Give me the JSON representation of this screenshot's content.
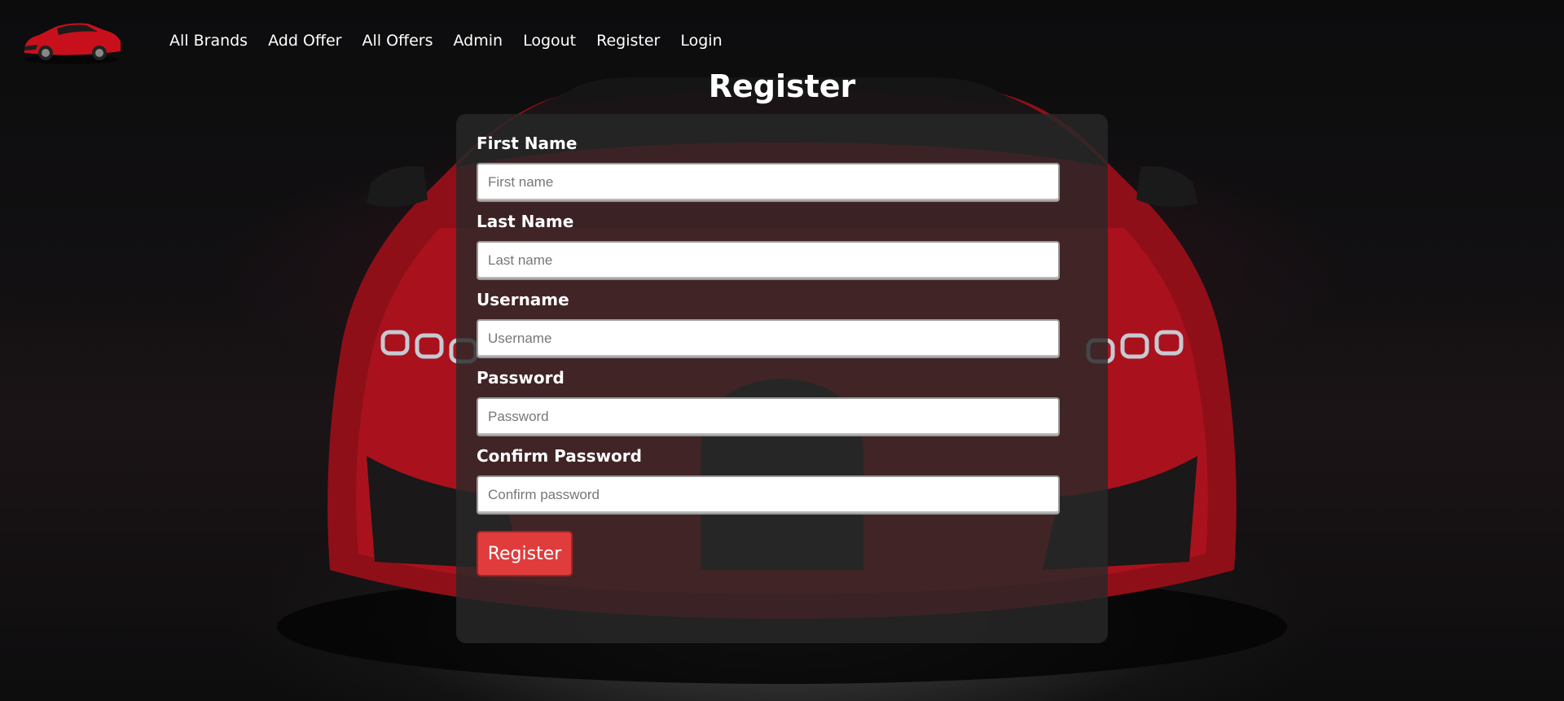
{
  "nav": {
    "logo_icon": "red-sports-car-logo",
    "links": [
      "All Brands",
      "Add Offer",
      "All Offers",
      "Admin",
      "Logout",
      "Register",
      "Login"
    ]
  },
  "page": {
    "title": "Register"
  },
  "form": {
    "fields": [
      {
        "label": "First Name",
        "placeholder": "First name",
        "value": ""
      },
      {
        "label": "Last Name",
        "placeholder": "Last name",
        "value": ""
      },
      {
        "label": "Username",
        "placeholder": "Username",
        "value": ""
      },
      {
        "label": "Password",
        "placeholder": "Password",
        "value": ""
      },
      {
        "label": "Confirm Password",
        "placeholder": "Confirm password",
        "value": ""
      }
    ],
    "submit_label": "Register"
  },
  "colors": {
    "accent": "#e03c3c",
    "panel": "#282828",
    "text": "#ffffff"
  }
}
